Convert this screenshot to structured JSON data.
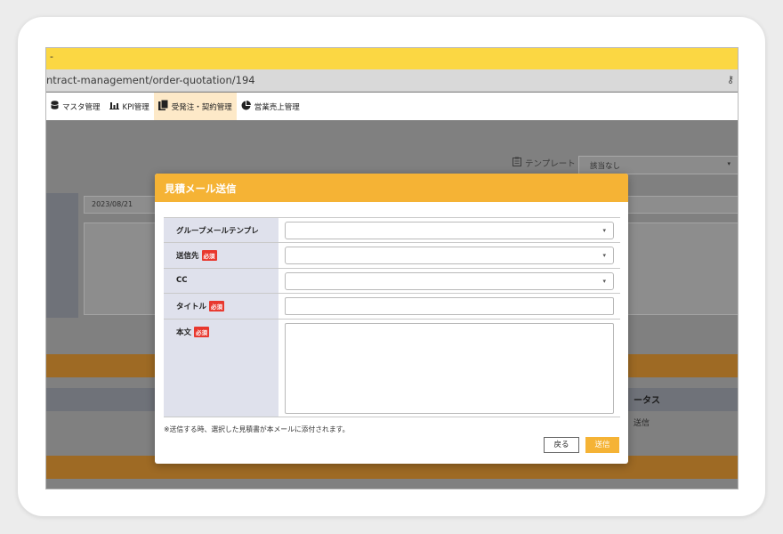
{
  "browser": {
    "tab_text": "-",
    "url": "ntract-management/order-quotation/194",
    "key_icon": "key-icon"
  },
  "nav": {
    "items": [
      {
        "label": "マスタ管理",
        "icon": "database-icon"
      },
      {
        "label": "KPI管理",
        "icon": "bar-chart-icon"
      },
      {
        "label": "受発注・契約管理",
        "icon": "document-icon"
      },
      {
        "label": "営業売上管理",
        "icon": "pie-chart-icon"
      }
    ]
  },
  "background": {
    "template_label": "テンプレート",
    "template_value": "該当なし",
    "date": "2023/08/21",
    "status_header": "ータス",
    "status_value": "送信"
  },
  "modal": {
    "title": "見積メール送信",
    "fields": [
      {
        "label": "グループメールテンプレ",
        "required": false,
        "type": "select",
        "value": ""
      },
      {
        "label": "送信先",
        "required": true,
        "type": "select",
        "value": ""
      },
      {
        "label": "CC",
        "required": false,
        "type": "select",
        "value": ""
      },
      {
        "label": "タイトル",
        "required": true,
        "type": "text",
        "value": ""
      },
      {
        "label": "本文",
        "required": true,
        "type": "textarea",
        "value": ""
      }
    ],
    "required_badge": "必須",
    "note": "※送信する時、選択した見積書が本メールに添付されます。",
    "back_label": "戻る",
    "send_label": "送信"
  },
  "colors": {
    "accent": "#f5b335",
    "brand_yellow": "#fbd743",
    "band_brown": "#9e6a24",
    "required_red": "#e8382e"
  }
}
